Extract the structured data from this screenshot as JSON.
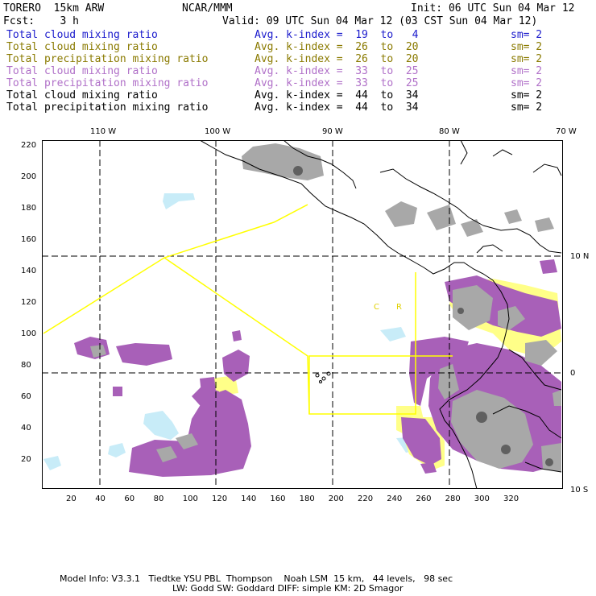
{
  "header": {
    "model": "TORERO  15km ARW",
    "org": "NCAR/MMM",
    "init": "Init: 06 UTC Sun 04 Mar 12",
    "fcst": "Fcst:    3 h",
    "valid": "Valid: 09 UTC Sun 04 Mar 12 (03 CST Sun 04 Mar 12)"
  },
  "legend": [
    {
      "name": "Total cloud mixing ratio",
      "kindex": "Avg. k-index =  19  to   4",
      "sm": "sm= 2",
      "color": "#1a1acc"
    },
    {
      "name": "Total cloud mixing ratio",
      "kindex": "Avg. k-index =  26  to  20",
      "sm": "sm= 2",
      "color": "#8a7a00"
    },
    {
      "name": "Total precipitation mixing ratio",
      "kindex": "Avg. k-index =  26  to  20",
      "sm": "sm= 2",
      "color": "#8a7a00"
    },
    {
      "name": "Total cloud mixing ratio",
      "kindex": "Avg. k-index =  33  to  25",
      "sm": "sm= 2",
      "color": "#b070c8"
    },
    {
      "name": "Total precipitation mixing ratio",
      "kindex": "Avg. k-index =  33  to  25",
      "sm": "sm= 2",
      "color": "#b070c8"
    },
    {
      "name": "Total cloud mixing ratio",
      "kindex": "Avg. k-index =  44  to  34",
      "sm": "sm= 2",
      "color": "#000000"
    },
    {
      "name": "Total precipitation mixing ratio",
      "kindex": "Avg. k-index =  44  to  34",
      "sm": "sm= 2",
      "color": "#000000"
    }
  ],
  "map": {
    "top_lon_labels": [
      "110 W",
      "100 W",
      "90 W",
      "80 W",
      "70 W"
    ],
    "right_lat_labels": [
      "10 N",
      "0",
      "10 S"
    ],
    "y_grid_labels": [
      "220",
      "200",
      "180",
      "160",
      "140",
      "120",
      "100",
      "80",
      "60",
      "40",
      "20"
    ],
    "x_grid_labels": [
      "20",
      "40",
      "60",
      "80",
      "100",
      "120",
      "140",
      "160",
      "180",
      "200",
      "220",
      "240",
      "260",
      "280",
      "300",
      "320"
    ],
    "region_labels": [
      "C",
      "R"
    ],
    "colors": {
      "light_blue": "#c8ecf8",
      "yellow": "#ffff88",
      "purple": "#a860b8",
      "gray": "#a8a8a8",
      "coast": "#000000",
      "domain": "#ffff00"
    }
  },
  "footer": {
    "line1": "Model Info: V3.3.1   Tiedtke YSU PBL  Thompson    Noah LSM  15 km,   44 levels,   98 sec",
    "line2": "LW: Godd SW: Goddard DIFF: simple KM: 2D Smagor"
  }
}
